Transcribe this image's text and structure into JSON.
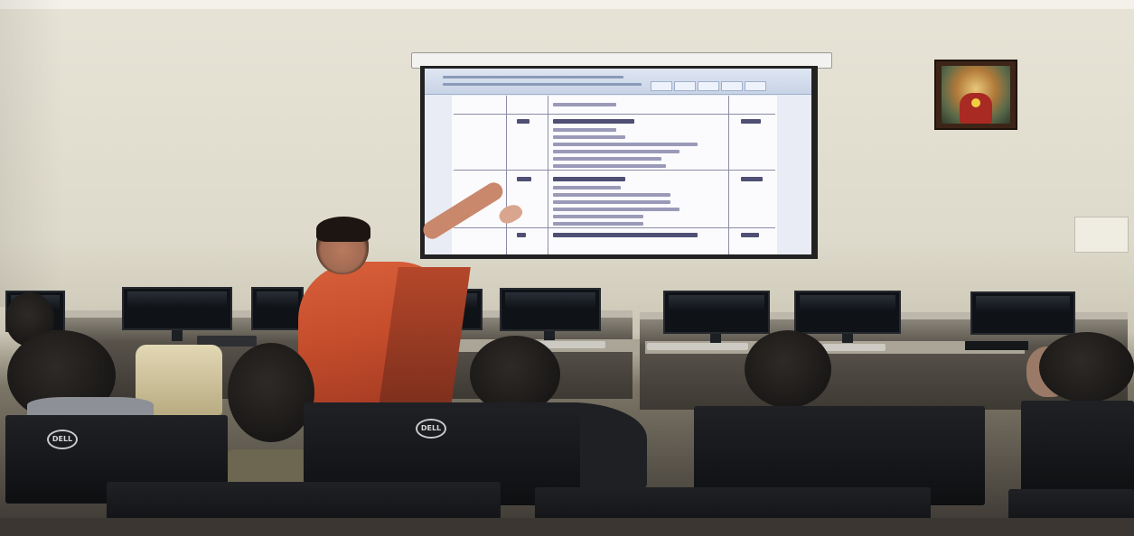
{
  "scene": {
    "description_kind": "photo",
    "objects": {
      "projector_screen": true,
      "presenter": true,
      "front_monitor_brand": "DELL"
    }
  },
  "colors": {
    "wall": "#e7e3d6",
    "saree": "#d9603a",
    "monitor": "#0f1216",
    "screen_bg": "#e9ecf4"
  },
  "labels": {
    "dell_left": "DELL",
    "dell_center": "DELL"
  }
}
